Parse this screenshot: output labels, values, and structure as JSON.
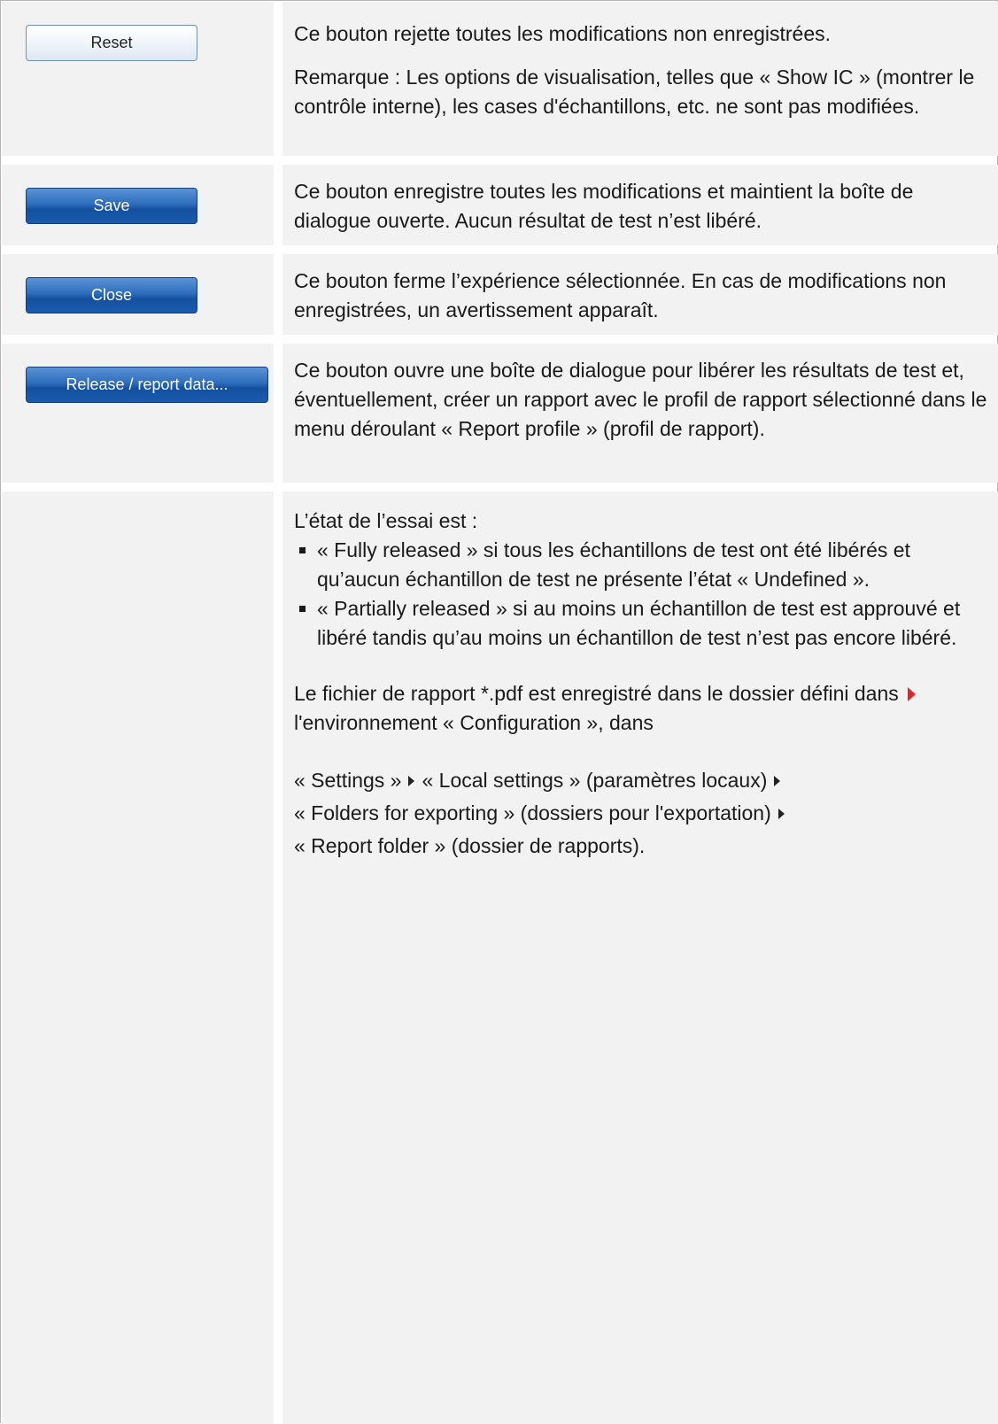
{
  "rows": [
    {
      "button_label": "Reset",
      "paragraphs": [
        "Ce bouton rejette toutes les modifications non enregistrées.",
        "Remarque : Les options de visualisation, telles que « Show IC » (montrer le contrôle interne), les cases d'échantillons, etc. ne sont pas modifiées."
      ]
    },
    {
      "button_label": "Save",
      "paragraphs": [
        "Ce bouton enregistre toutes les modifications et maintient la boîte de dialogue ouverte. Aucun résultat de test n’est libéré."
      ]
    },
    {
      "button_label": "Close",
      "paragraphs": [
        "Ce bouton ferme l’expérience sélectionnée. En cas de modifications non enregistrées, un avertissement apparaît."
      ]
    },
    {
      "button_label": "Release / report data...",
      "paragraphs": [
        "Ce bouton ouvre une boîte de dialogue pour libérer les résultats de test et, éventuellement, créer un rapport avec le profil de rapport sélectionné dans le menu déroulant « Report profile » (profil de rapport)."
      ]
    }
  ],
  "details": {
    "intro": "L’état de l’essai est :",
    "bullets": [
      "« Fully released » si tous les échantillons de test ont été libérés et qu’aucun échantillon de test ne présente l’état « Undefined ».",
      "« Partially released » si au moins un échantillon de test est approuvé et libéré tandis qu’au moins un échantillon de test n’est pas encore libéré."
    ],
    "report_text_before": "Le fichier de rapport *.pdf est enregistré dans le dossier défini dans",
    "report_link": "l'environnement « Configuration », dans",
    "path_settings": "« Settings »",
    "path_local": "« Local settings » (paramètres locaux)",
    "path_folders": "« Folders for exporting » (dossiers pour l'exportation)",
    "path_report": "« Report folder » (dossier de rapports)."
  },
  "colors": {
    "cell_bg": "#f2f2f2",
    "button_blue": "#1a5bad",
    "link_arrow_red": "#e3262b"
  },
  "icons": {
    "link_arrow": "red-right-triangle",
    "path_separator": "black-right-triangle",
    "bullet": "black-square"
  }
}
